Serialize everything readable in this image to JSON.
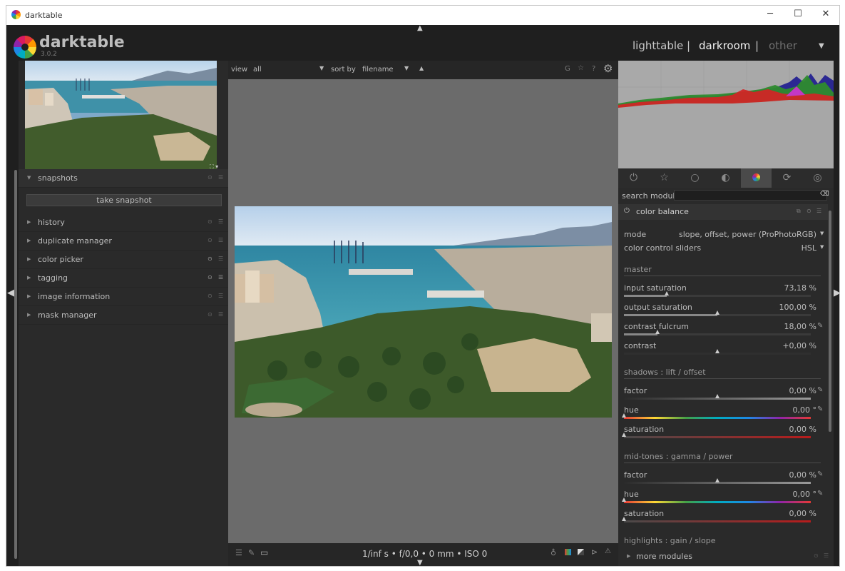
{
  "window": {
    "title": "darktable",
    "minimize": "─",
    "maximize": "☐",
    "close": "✕"
  },
  "logo": {
    "name": "darktable",
    "version": "3.0.2"
  },
  "views": {
    "lighttable": "lighttable",
    "darkroom": "darkroom",
    "other": "other",
    "sep1": "|",
    "sep2": "|",
    "menu_caret": "▼"
  },
  "left": {
    "modules": [
      {
        "label": "snapshots"
      },
      {
        "label": "history"
      },
      {
        "label": "duplicate manager"
      },
      {
        "label": "color picker"
      },
      {
        "label": "tagging"
      },
      {
        "label": "image information"
      },
      {
        "label": "mask manager"
      }
    ],
    "snapshot_button": "take snapshot"
  },
  "filmstrip": {
    "view_label": "view",
    "view_value": "all",
    "sort_label": "sort by",
    "sort_value": "filename",
    "sort_dir": "▲",
    "icons": {
      "grouping": "G",
      "star": "☆",
      "help": "?",
      "gear": "⚙"
    }
  },
  "info_line": "1/inf s • f/0,0 • 0 mm • ISO 0",
  "search": {
    "label": "search module"
  },
  "color_balance": {
    "title": "color balance",
    "mode_label": "mode",
    "mode_value": "slope, offset, power (ProPhotoRGB)",
    "sliders_label": "color control sliders",
    "sliders_value": "HSL",
    "master_section": "master",
    "input_saturation_label": "input saturation",
    "input_saturation_value": "73,18 %",
    "input_saturation_level": 0.23,
    "output_saturation_label": "output saturation",
    "output_saturation_value": "100,00 %",
    "output_saturation_level": 0.5,
    "contrast_fulcrum_label": "contrast fulcrum",
    "contrast_fulcrum_value": "18,00 %",
    "contrast_fulcrum_level": 0.18,
    "contrast_label": "contrast",
    "contrast_value": "+0,00 %",
    "contrast_level": 0.5,
    "shadows_section": "shadows : lift / offset",
    "shadows_factor_label": "factor",
    "shadows_factor_value": "0,00 %",
    "shadows_hue_label": "hue",
    "shadows_hue_value": "0,00 °",
    "shadows_saturation_label": "saturation",
    "shadows_saturation_value": "0,00 %",
    "midtones_section": "mid-tones : gamma / power",
    "mid_factor_label": "factor",
    "mid_factor_value": "0,00 %",
    "mid_hue_label": "hue",
    "mid_hue_value": "0,00 °",
    "mid_saturation_label": "saturation",
    "mid_saturation_value": "0,00 %",
    "highlights_section": "highlights : gain / slope"
  },
  "more_modules": "more modules",
  "colors": {
    "accent": "#4a4a4a",
    "panel": "#2a2a2a",
    "center": "#6b6b6b"
  }
}
